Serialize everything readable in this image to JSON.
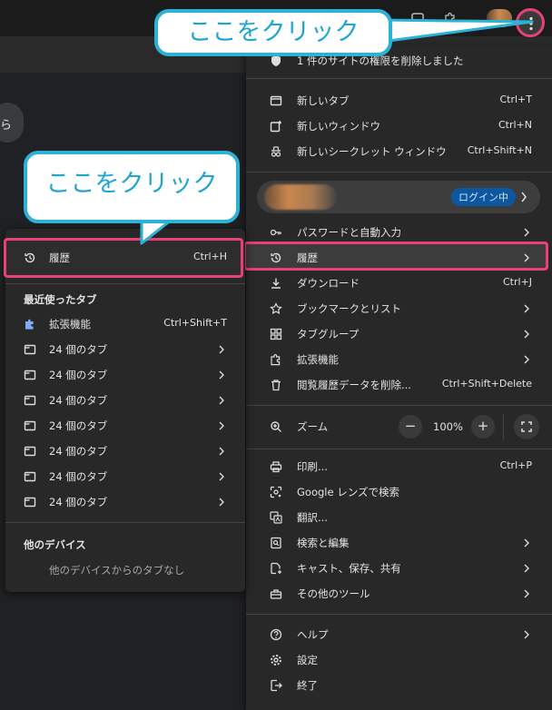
{
  "callouts": {
    "top": "ここをクリック",
    "left": "ここをクリック"
  },
  "page": {
    "partial_text": "ら"
  },
  "menu": {
    "permission_notice": "1 件のサイトの権限を削除しました",
    "items_a": [
      {
        "label": "新しいタブ",
        "shortcut": "Ctrl+T",
        "icon": "new-tab-icon"
      },
      {
        "label": "新しいウィンドウ",
        "shortcut": "Ctrl+N",
        "icon": "new-window-icon"
      },
      {
        "label": "新しいシークレット ウィンドウ",
        "shortcut": "Ctrl+Shift+N",
        "icon": "incognito-icon"
      }
    ],
    "profile_badge": "ログイン中",
    "items_b": [
      {
        "label": "パスワードと自動入力",
        "icon": "key-icon"
      },
      {
        "label": "履歴",
        "icon": "history-icon"
      },
      {
        "label": "ダウンロード",
        "shortcut": "Ctrl+J",
        "icon": "download-icon"
      },
      {
        "label": "ブックマークとリスト",
        "icon": "star-icon"
      },
      {
        "label": "タブグループ",
        "icon": "tab-groups-icon"
      },
      {
        "label": "拡張機能",
        "icon": "extension-icon"
      },
      {
        "label": "閲覧履歴データを削除...",
        "shortcut": "Ctrl+Shift+Delete",
        "icon": "trash-icon"
      }
    ],
    "zoom": {
      "label": "ズーム",
      "minus": "−",
      "value": "100%",
      "plus": "+"
    },
    "items_c": [
      {
        "label": "印刷...",
        "shortcut": "Ctrl+P",
        "icon": "print-icon"
      },
      {
        "label": "Google レンズで検索",
        "icon": "lens-icon"
      },
      {
        "label": "翻訳...",
        "icon": "translate-icon"
      },
      {
        "label": "検索と編集",
        "icon": "search-edit-icon"
      },
      {
        "label": "キャスト、保存、共有",
        "icon": "cast-icon"
      },
      {
        "label": "その他のツール",
        "icon": "toolbox-icon"
      }
    ],
    "items_d": [
      {
        "label": "ヘルプ",
        "icon": "help-icon"
      },
      {
        "label": "設定",
        "icon": "settings-icon"
      },
      {
        "label": "終了",
        "icon": "exit-icon"
      }
    ]
  },
  "submenu": {
    "history": {
      "label": "履歴",
      "shortcut": "Ctrl+H",
      "icon": "history-icon"
    },
    "recent_heading": "最近使ったタブ",
    "extensions": {
      "label": "拡張機能",
      "shortcut": "Ctrl+Shift+T",
      "icon": "puzzle-icon"
    },
    "tab_groups": [
      "24 個のタブ",
      "24 個のタブ",
      "24 個のタブ",
      "24 個のタブ",
      "24 個のタブ",
      "24 個のタブ",
      "24 個のタブ"
    ],
    "other_devices_heading": "他のデバイス",
    "other_devices_note": "他のデバイスからのタブなし"
  }
}
